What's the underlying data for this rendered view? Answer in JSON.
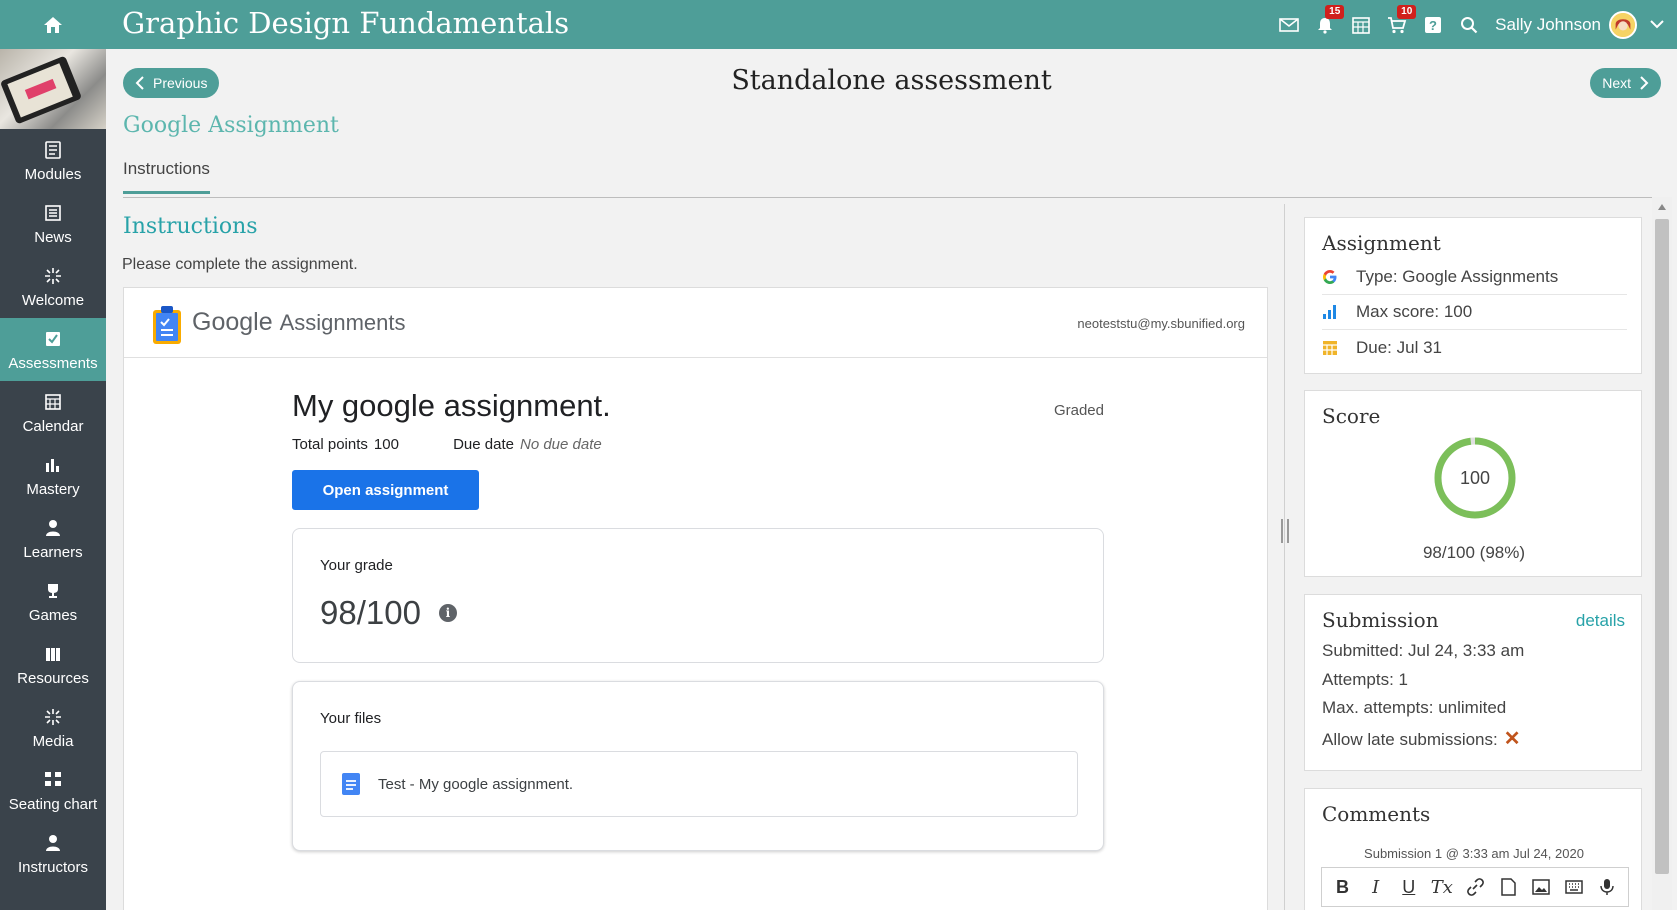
{
  "app": {
    "title": "Graphic Design Fundamentals",
    "user_name": "Sally Johnson",
    "notification_count": "15",
    "cart_count": "10",
    "accent": "#4e9e98"
  },
  "sidebar": {
    "items": [
      {
        "label": "Modules",
        "icon": "modules-icon"
      },
      {
        "label": "News",
        "icon": "news-icon"
      },
      {
        "label": "Welcome",
        "icon": "welcome-icon"
      },
      {
        "label": "Assessments",
        "icon": "assessments-icon",
        "active": true
      },
      {
        "label": "Calendar",
        "icon": "calendar-icon"
      },
      {
        "label": "Mastery",
        "icon": "mastery-icon"
      },
      {
        "label": "Learners",
        "icon": "learners-icon"
      },
      {
        "label": "Games",
        "icon": "trophy-icon"
      },
      {
        "label": "Resources",
        "icon": "resources-icon"
      },
      {
        "label": "Media",
        "icon": "media-icon"
      },
      {
        "label": "Seating chart",
        "icon": "seating-chart-icon"
      },
      {
        "label": "Instructors",
        "icon": "instructors-icon"
      }
    ]
  },
  "nav": {
    "previous_label": "Previous",
    "next_label": "Next",
    "page_title": "Standalone assessment"
  },
  "assignment_title": "Google Assignment",
  "tabs": [
    {
      "label": "Instructions",
      "active": true
    }
  ],
  "instructions": {
    "heading": "Instructions",
    "text": "Please complete the assignment."
  },
  "google": {
    "brand_google": "Google",
    "brand_assignments": "Assignments",
    "email": "neoteststu@my.sbunified.org",
    "assignment_title": "My google assignment.",
    "status": "Graded",
    "total_points_label": "Total points",
    "total_points_value": "100",
    "due_date_label": "Due date",
    "due_date_value": "No due date",
    "open_button": "Open assignment",
    "grade_label": "Your grade",
    "grade_value": "98/100",
    "files_label": "Your files",
    "file_name": "Test - My google assignment."
  },
  "assignment_panel": {
    "title": "Assignment",
    "type": "Type: Google Assignments",
    "max_score": "Max score: 100",
    "due": "Due: Jul 31"
  },
  "score_panel": {
    "title": "Score",
    "center_value": "100",
    "summary": "98/100 (98%)",
    "percent": 98,
    "ring_color": "#7cbf5a"
  },
  "submission_panel": {
    "title": "Submission",
    "details_link": "details",
    "submitted": "Submitted: Jul 24, 3:33 am",
    "attempts": "Attempts: 1",
    "max_attempts": "Max. attempts: unlimited",
    "late_label": "Allow late submissions:",
    "late_value": "✕"
  },
  "comments_panel": {
    "title": "Comments",
    "submission_info": "Submission 1 @ 3:33 am Jul 24, 2020",
    "toolbar": [
      "B",
      "I",
      "U",
      "Tx",
      "link",
      "file",
      "image",
      "keyboard",
      "microphone"
    ]
  }
}
